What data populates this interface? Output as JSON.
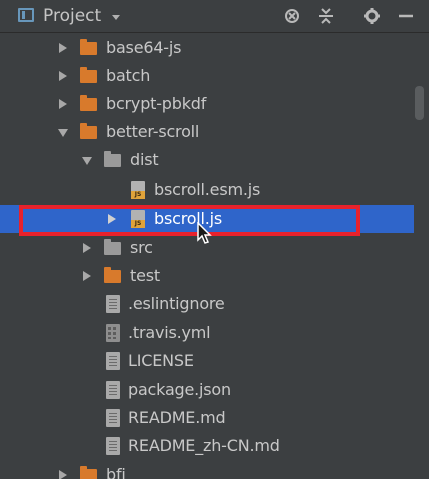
{
  "header": {
    "title": "Project",
    "tool_icons": [
      "locate-target-icon",
      "collapse-all-icon",
      "settings-gear-icon",
      "hide-panel-icon"
    ]
  },
  "tree": {
    "rows": [
      {
        "label": "base64-js",
        "type": "folder",
        "expanded": false
      },
      {
        "label": "batch",
        "type": "folder",
        "expanded": false
      },
      {
        "label": "bcrypt-pbkdf",
        "type": "folder",
        "expanded": false
      },
      {
        "label": "better-scroll",
        "type": "folder",
        "expanded": true
      },
      {
        "label": "dist",
        "type": "folder",
        "expanded": true
      },
      {
        "label": "bscroll.esm.js",
        "type": "js-file"
      },
      {
        "label": "bscroll.js",
        "type": "js-file",
        "selected": true
      },
      {
        "label": "src",
        "type": "folder",
        "expanded": false
      },
      {
        "label": "test",
        "type": "folder",
        "expanded": false
      },
      {
        "label": ".eslintignore",
        "type": "text-file"
      },
      {
        "label": ".travis.yml",
        "type": "yml-file"
      },
      {
        "label": "LICENSE",
        "type": "text-file"
      },
      {
        "label": "package.json",
        "type": "text-file"
      },
      {
        "label": "README.md",
        "type": "text-file"
      },
      {
        "label": "README_zh-CN.md",
        "type": "text-file"
      },
      {
        "label": "bfj",
        "type": "folder",
        "expanded": false
      }
    ]
  },
  "colors": {
    "background": "#3c3f41",
    "selection": "#2f65ca",
    "highlight_border": "#e8222c",
    "folder_orange": "#d87a2c",
    "folder_grey": "#9a9a9a"
  }
}
